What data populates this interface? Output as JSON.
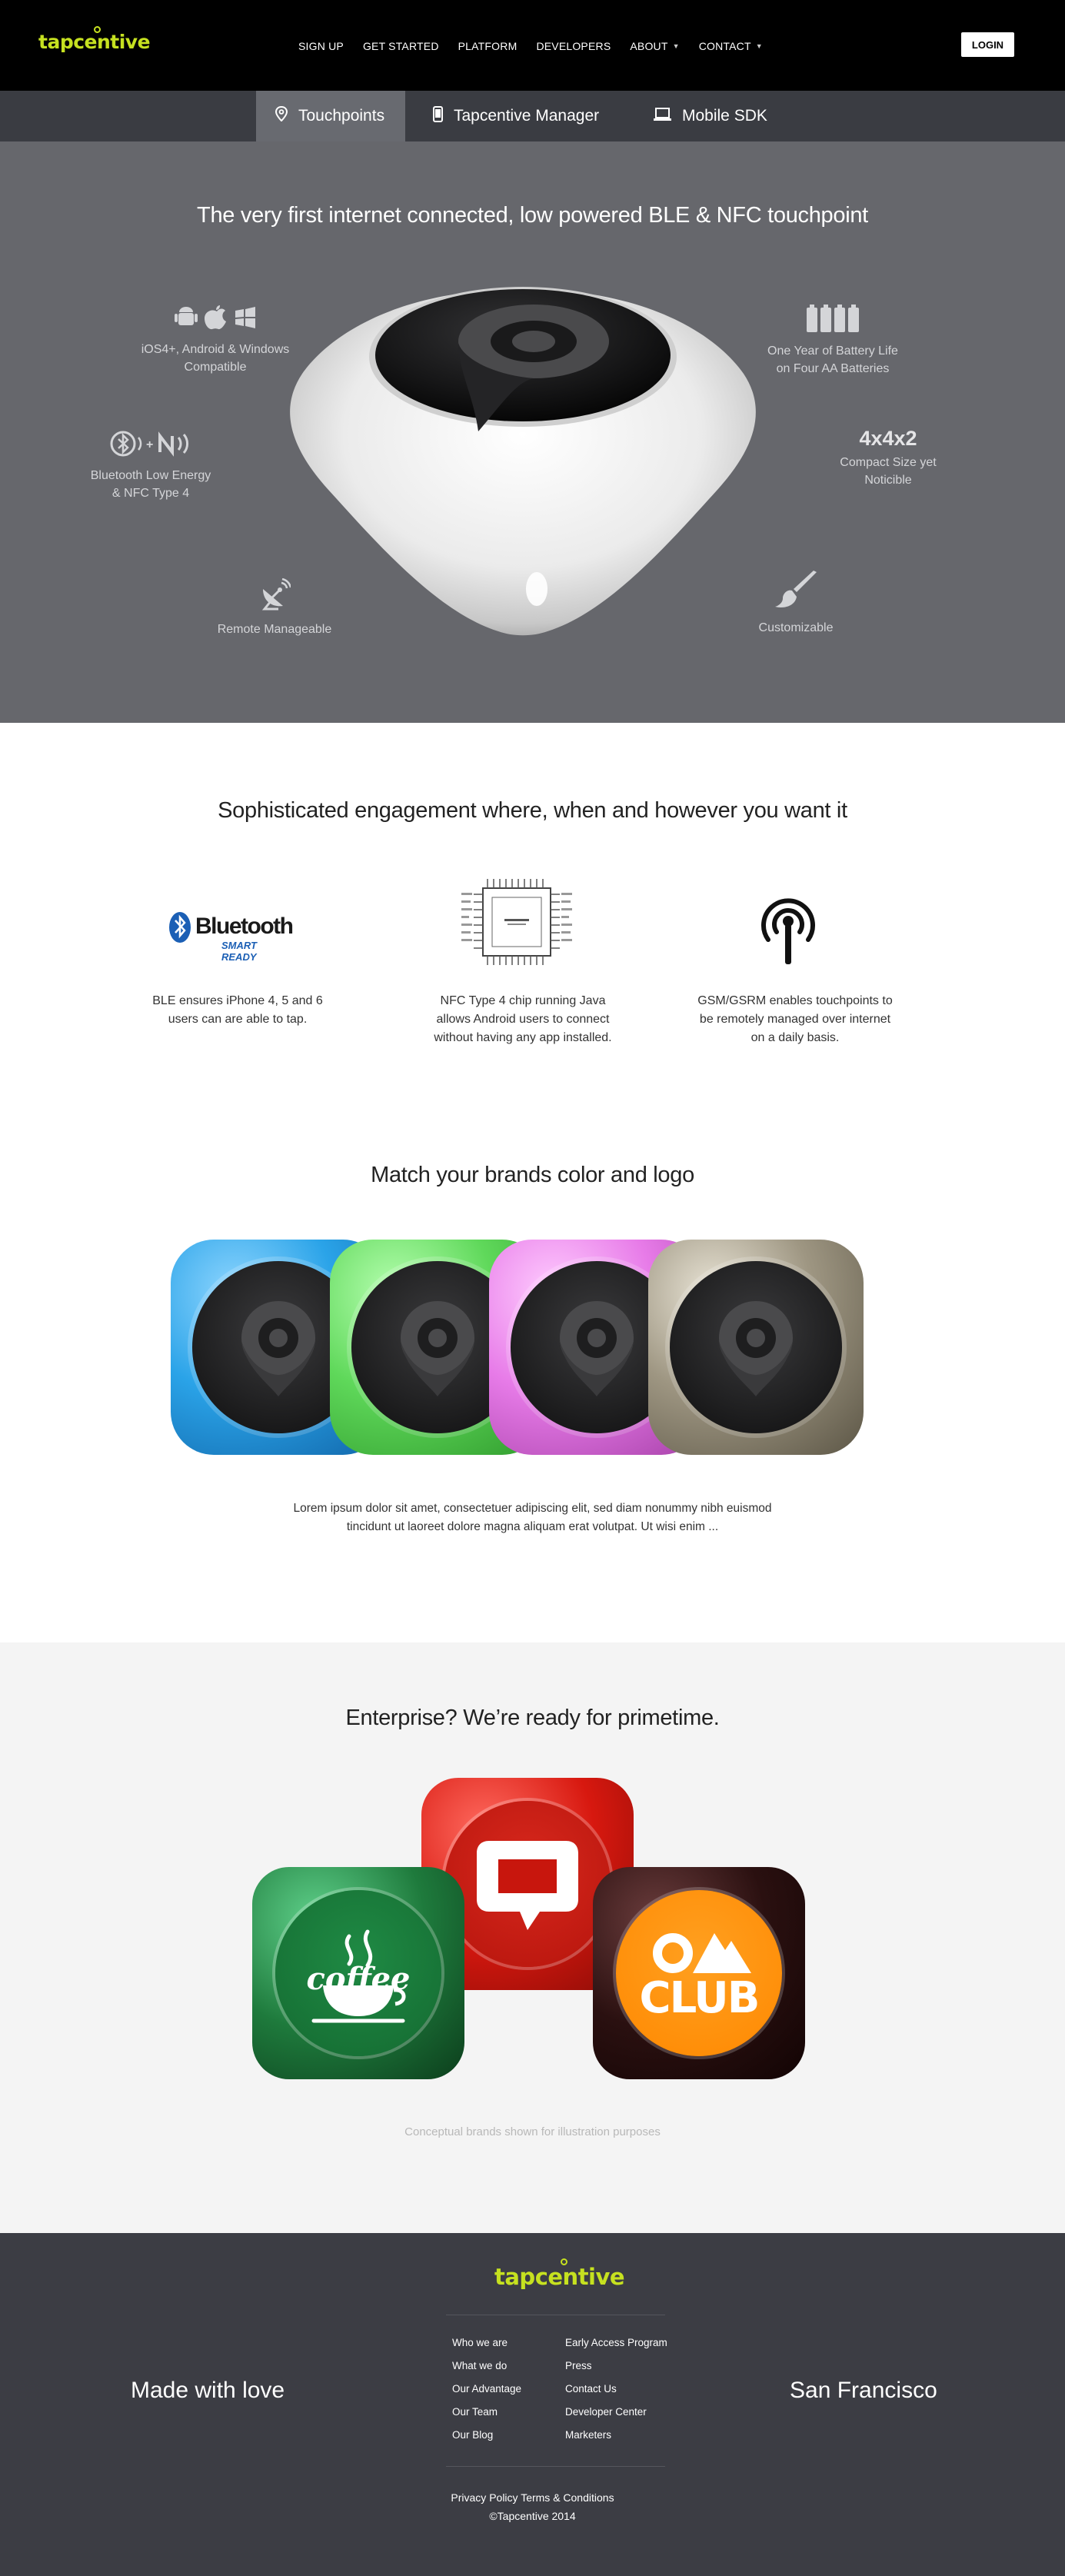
{
  "header": {
    "logo": "tapcentive",
    "nav": [
      {
        "label": "SIGN UP",
        "caret": false
      },
      {
        "label": "GET STARTED",
        "caret": false
      },
      {
        "label": "PLATFORM",
        "caret": false
      },
      {
        "label": "DEVELOPERS",
        "caret": false
      },
      {
        "label": "ABOUT",
        "caret": true
      },
      {
        "label": "CONTACT",
        "caret": true
      }
    ],
    "login_label": "LOGIN"
  },
  "subnav": {
    "tabs": [
      {
        "label": "Touchpoints",
        "icon": "location-pin-icon",
        "active": true
      },
      {
        "label": "Tapcentive Manager",
        "icon": "phone-icon",
        "active": false
      },
      {
        "label": "Mobile SDK",
        "icon": "laptop-icon",
        "active": false
      }
    ]
  },
  "hero": {
    "title": "The very first internet connected, low powered BLE & NFC touchpoint",
    "features": {
      "os": {
        "line1": "iOS4+, Android & Windows",
        "line2": "Compatible",
        "icon": "platform-logos-icon"
      },
      "ble": {
        "line1": "Bluetooth Low Energy",
        "line2": "& NFC Type 4",
        "icon": "ble-nfc-icon"
      },
      "remote": {
        "line1": "Remote Manageable",
        "icon": "satellite-dish-icon"
      },
      "battery": {
        "line1": "One Year of Battery Life",
        "line2": "on Four AA Batteries",
        "icon": "batteries-icon"
      },
      "size": {
        "big": "4x4x2",
        "line1": "Compact Size yet",
        "line2": "Noticible"
      },
      "custom": {
        "line1": "Customizable",
        "icon": "paintbrush-icon"
      }
    }
  },
  "engagement": {
    "title": "Sophisticated engagement where, when and however you want it",
    "bluetooth_logo": {
      "word": "Bluetooth",
      "tag": "SMART READY"
    },
    "items": [
      {
        "text1": "BLE ensures iPhone 4, 5 and 6",
        "text2": "users can are able to tap.",
        "icon": "bluetooth-smart-ready-logo"
      },
      {
        "text1": "NFC Type 4 chip running Java",
        "text2": "allows Android users to connect",
        "text3": "without having any app installed.",
        "icon": "nfc-chip-diagram"
      },
      {
        "text1": "GSM/GSRM enables touchpoints to",
        "text2": "be remotely managed over internet",
        "text3": "on a daily basis.",
        "icon": "broadcast-antenna-icon"
      }
    ]
  },
  "brand_colors": {
    "title": "Match your brands color and logo",
    "pucks": [
      {
        "color": "#2aa3e8",
        "name": "blue"
      },
      {
        "color": "#5fd85a",
        "name": "green"
      },
      {
        "color": "#e77be8",
        "name": "pink"
      },
      {
        "color": "#9e9682",
        "name": "bronze"
      }
    ],
    "lorem1": "Lorem ipsum dolor sit amet, consectetuer adipiscing elit, sed diam nonummy nibh euismod",
    "lorem2": "tincidunt ut laoreet dolore magna aliquam erat volutpat. Ut wisi enim ..."
  },
  "enterprise": {
    "title": "Enterprise? We’re ready for primetime.",
    "brands": [
      {
        "name": "coffee",
        "text": "coffee",
        "color": "#1e7a3c"
      },
      {
        "name": "chat",
        "color": "#d7180f"
      },
      {
        "name": "club",
        "text": "CLUB",
        "color": "#ff8c00"
      }
    ],
    "disclaimer": "Conceptual brands shown for illustration purposes"
  },
  "footer": {
    "logo": "tapcentive",
    "left": "Made with love",
    "right": "San Francisco",
    "col1": [
      "Who we are",
      "What we do",
      "Our Advantage",
      "Our Team",
      "Our Blog"
    ],
    "col2": [
      "Early Access Program",
      "Press",
      "Contact Us",
      "Developer Center",
      "Marketers"
    ],
    "privacy": "Privacy Policy",
    "terms": "Terms & Conditions",
    "copyright": "©Tapcentive  2014"
  }
}
